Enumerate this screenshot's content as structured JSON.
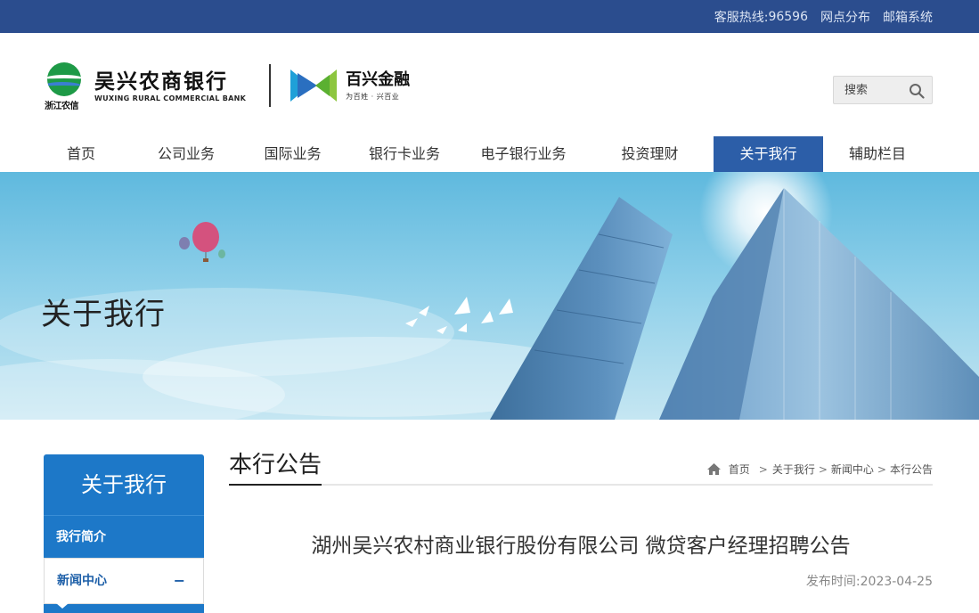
{
  "topbar": {
    "hotline_label": "客服热线:",
    "hotline_value": "96596",
    "branch_link": "网点分布",
    "mail_link": "邮箱系统"
  },
  "header": {
    "emblem_text": "浙江农信",
    "bank_name_cn": "吴兴农商银行",
    "bank_name_en": "WUXING RURAL COMMERCIAL BANK",
    "partner_name": "百兴金融",
    "partner_slogan": "为百姓 · 兴百业",
    "search_placeholder": "搜索"
  },
  "nav": {
    "items": [
      {
        "label": "首页"
      },
      {
        "label": "公司业务"
      },
      {
        "label": "国际业务"
      },
      {
        "label": "银行卡业务"
      },
      {
        "label": "电子银行业务"
      },
      {
        "label": "投资理财"
      },
      {
        "label": "关于我行"
      },
      {
        "label": "辅助栏目"
      }
    ],
    "active_index": 6
  },
  "banner": {
    "title": "关于我行"
  },
  "sidebar": {
    "heading": "关于我行",
    "items": [
      {
        "label": "我行简介"
      },
      {
        "label": "新闻中心",
        "toggle": "−"
      }
    ]
  },
  "content": {
    "section_title": "本行公告",
    "breadcrumb": [
      "首页",
      "关于我行",
      "新闻中心",
      "本行公告"
    ],
    "article_title": "湖州吴兴农村商业银行股份有限公司 微贷客户经理招聘公告",
    "published_label": "发布时间:",
    "published_date": "2023-04-25"
  },
  "colors": {
    "topbar": "#2b4d8e",
    "nav_active": "#2c5ea8",
    "sidebar": "#1d78c8"
  }
}
